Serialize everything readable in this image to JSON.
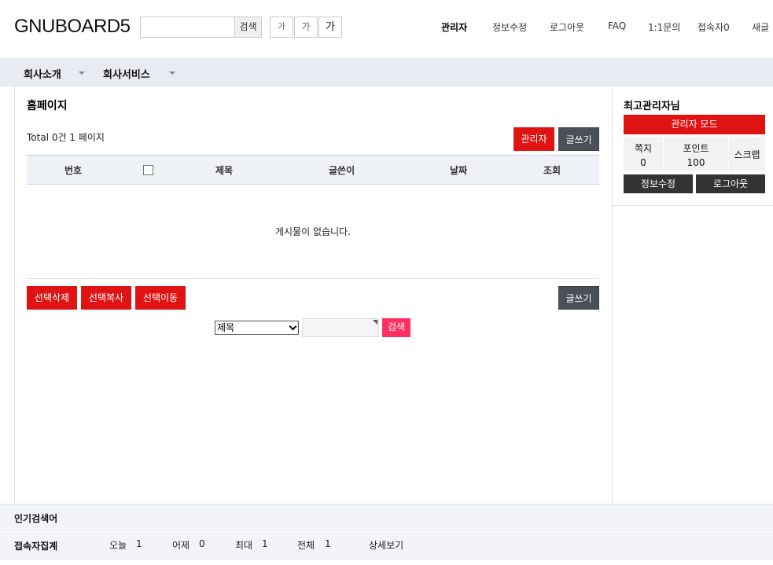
{
  "header": {
    "logo": "GNUBOARD5",
    "search_button": "검색",
    "font_small": "가",
    "font_medium": "가",
    "font_large": "가",
    "links": [
      "관리자",
      "정보수정",
      "로그아웃",
      "FAQ",
      "1:1문의",
      "접속자0",
      "새글"
    ]
  },
  "gnb": {
    "items": [
      "회사소개",
      "회사서비스"
    ]
  },
  "board": {
    "title": "홈페이지",
    "total": "Total 0건 1 페이지",
    "admin_button": "관리자",
    "write_button": "글쓰기",
    "columns": [
      "번호",
      "제목",
      "글쓴이",
      "날짜",
      "조회"
    ],
    "empty_message": "게시물이 없습니다.",
    "delete_button": "선택삭제",
    "copy_button": "선택복사",
    "move_button": "선택이동",
    "write_button_bottom": "글쓰기",
    "search_field": "제목",
    "search_button": "검색"
  },
  "aside": {
    "user_title": "최고관리자님",
    "admin_mode": "관리자 모드",
    "memo_label": "쪽지",
    "memo_count": "0",
    "point_label": "포인트",
    "point_value": "100",
    "scrap_label": "스크랩",
    "edit_button": "정보수정",
    "logout_button": "로그아웃"
  },
  "footer": {
    "popular_title": "인기검색어",
    "visit_title": "접속자집계",
    "today_label": "오늘",
    "today_value": "1",
    "yesterday_label": "어제",
    "yesterday_value": "0",
    "max_label": "최대",
    "max_value": "1",
    "total_label": "전체",
    "total_value": "1",
    "detail_link": "상세보기"
  },
  "colors": {
    "accent_red": "#e01313",
    "search_pink": "#ff3061",
    "dark_button": "#4b5058",
    "nav_bg": "#e8ecf2"
  }
}
